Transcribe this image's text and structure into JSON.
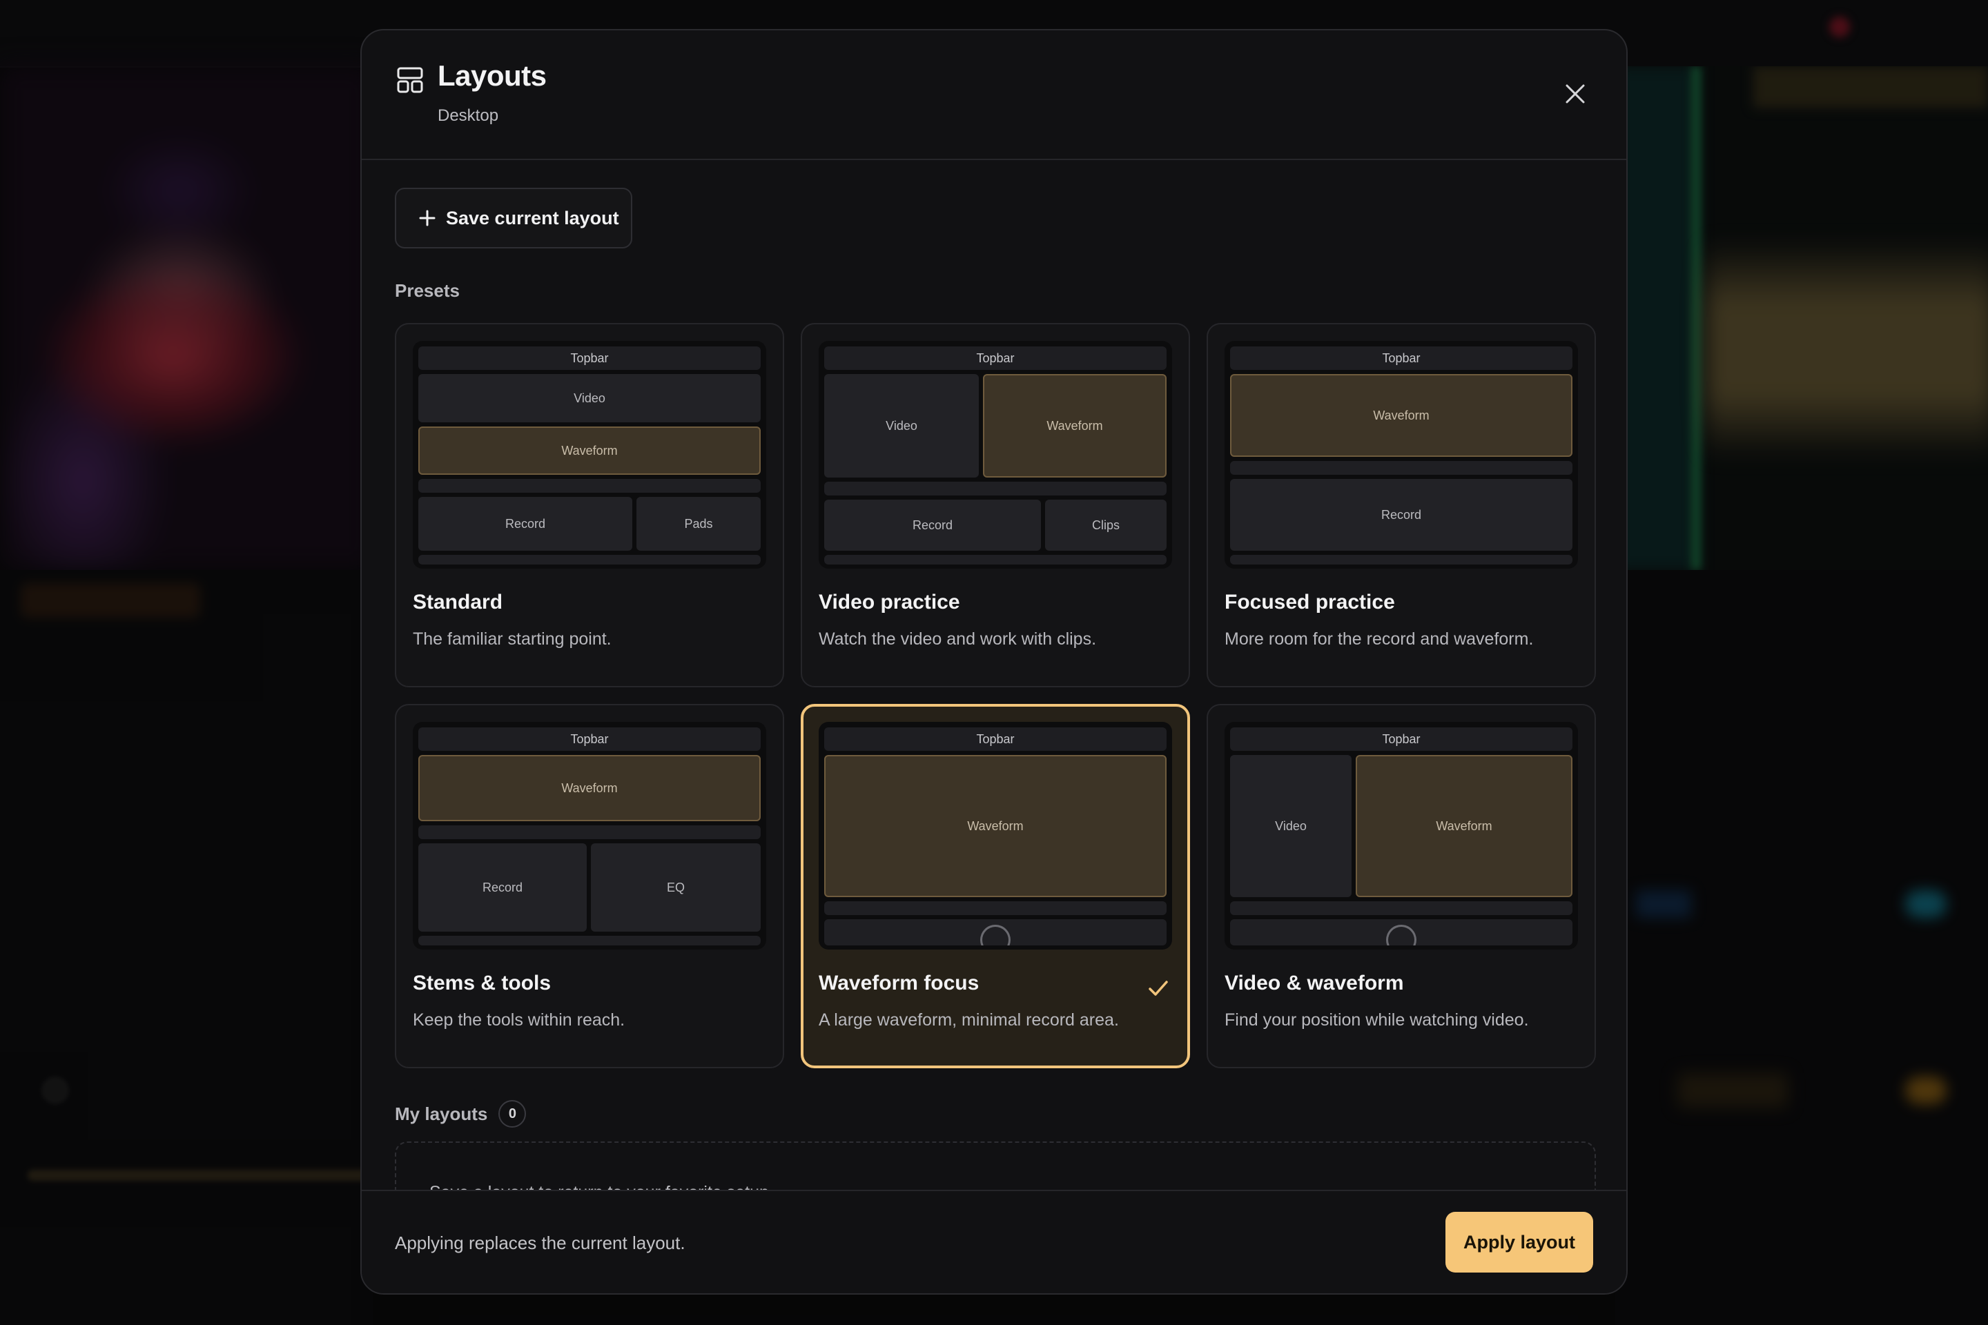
{
  "modal": {
    "title": "Layouts",
    "subtitle": "Desktop",
    "save_label": "Save current layout",
    "presets_label": "Presets",
    "my_layouts_label": "My layouts",
    "my_layouts_count": "0",
    "empty_message": "Save a layout to return to your favorite setup.",
    "footer_note": "Applying replaces the current layout.",
    "apply_label": "Apply layout",
    "selected_preset": "Waveform focus",
    "accent_color": "#f6c678"
  },
  "presets": [
    {
      "name": "Standard",
      "description": "The familiar starting point.",
      "blocks": {
        "topbar": "Topbar",
        "video": "Video",
        "waveform": "Waveform",
        "record": "Record",
        "pads": "Pads"
      }
    },
    {
      "name": "Video practice",
      "description": "Watch the video and work with clips.",
      "blocks": {
        "topbar": "Topbar",
        "video": "Video",
        "waveform": "Waveform",
        "record": "Record",
        "clips": "Clips"
      }
    },
    {
      "name": "Focused practice",
      "description": "More room for the record and waveform.",
      "blocks": {
        "topbar": "Topbar",
        "waveform": "Waveform",
        "record": "Record"
      }
    },
    {
      "name": "Stems & tools",
      "description": "Keep the tools within reach.",
      "blocks": {
        "topbar": "Topbar",
        "waveform": "Waveform",
        "record": "Record",
        "eq": "EQ"
      }
    },
    {
      "name": "Waveform focus",
      "description": "A large waveform, minimal record area.",
      "blocks": {
        "topbar": "Topbar",
        "waveform": "Waveform"
      }
    },
    {
      "name": "Video & waveform",
      "description": "Find your position while watching video.",
      "blocks": {
        "topbar": "Topbar",
        "video": "Video",
        "waveform": "Waveform"
      }
    }
  ]
}
